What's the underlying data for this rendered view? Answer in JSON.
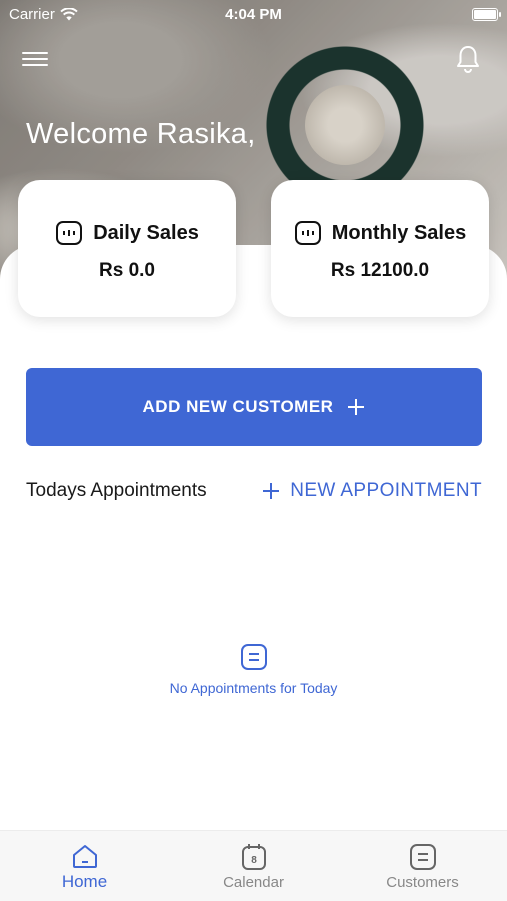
{
  "status_bar": {
    "carrier": "Carrier",
    "time": "4:04 PM"
  },
  "header": {
    "welcome": "Welcome Rasika,"
  },
  "stats": [
    {
      "label": "Daily Sales",
      "value": "Rs 0.0"
    },
    {
      "label": "Monthly Sales",
      "value": "Rs 12100.0"
    }
  ],
  "actions": {
    "add_customer": "ADD NEW CUSTOMER",
    "new_appointment": "NEW APPOINTMENT"
  },
  "appointments": {
    "title": "Todays Appointments",
    "empty_text": "No Appointments for Today"
  },
  "tabbar": {
    "home": "Home",
    "calendar": "Calendar",
    "calendar_day": "8",
    "customers": "Customers"
  },
  "colors": {
    "accent": "#3f67d4",
    "inactive": "#888888"
  },
  "icons": [
    "menu-icon",
    "bell-icon",
    "sales-icon",
    "plus-icon",
    "list-icon",
    "home-icon",
    "calendar-icon",
    "customers-icon",
    "wifi-icon",
    "battery-icon"
  ]
}
